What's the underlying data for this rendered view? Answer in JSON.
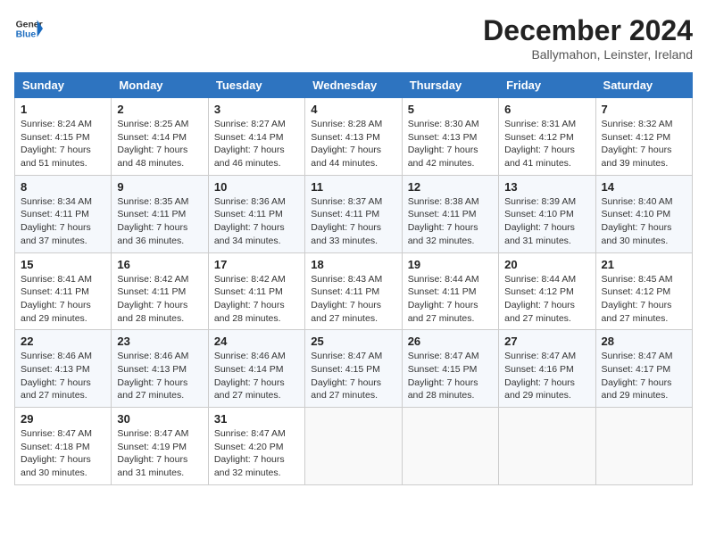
{
  "logo": {
    "line1": "General",
    "line2": "Blue"
  },
  "title": "December 2024",
  "subtitle": "Ballymahon, Leinster, Ireland",
  "days_header": [
    "Sunday",
    "Monday",
    "Tuesday",
    "Wednesday",
    "Thursday",
    "Friday",
    "Saturday"
  ],
  "weeks": [
    [
      {
        "day": "1",
        "sunrise": "8:24 AM",
        "sunset": "4:15 PM",
        "daylight": "7 hours and 51 minutes."
      },
      {
        "day": "2",
        "sunrise": "8:25 AM",
        "sunset": "4:14 PM",
        "daylight": "7 hours and 48 minutes."
      },
      {
        "day": "3",
        "sunrise": "8:27 AM",
        "sunset": "4:14 PM",
        "daylight": "7 hours and 46 minutes."
      },
      {
        "day": "4",
        "sunrise": "8:28 AM",
        "sunset": "4:13 PM",
        "daylight": "7 hours and 44 minutes."
      },
      {
        "day": "5",
        "sunrise": "8:30 AM",
        "sunset": "4:13 PM",
        "daylight": "7 hours and 42 minutes."
      },
      {
        "day": "6",
        "sunrise": "8:31 AM",
        "sunset": "4:12 PM",
        "daylight": "7 hours and 41 minutes."
      },
      {
        "day": "7",
        "sunrise": "8:32 AM",
        "sunset": "4:12 PM",
        "daylight": "7 hours and 39 minutes."
      }
    ],
    [
      {
        "day": "8",
        "sunrise": "8:34 AM",
        "sunset": "4:11 PM",
        "daylight": "7 hours and 37 minutes."
      },
      {
        "day": "9",
        "sunrise": "8:35 AM",
        "sunset": "4:11 PM",
        "daylight": "7 hours and 36 minutes."
      },
      {
        "day": "10",
        "sunrise": "8:36 AM",
        "sunset": "4:11 PM",
        "daylight": "7 hours and 34 minutes."
      },
      {
        "day": "11",
        "sunrise": "8:37 AM",
        "sunset": "4:11 PM",
        "daylight": "7 hours and 33 minutes."
      },
      {
        "day": "12",
        "sunrise": "8:38 AM",
        "sunset": "4:11 PM",
        "daylight": "7 hours and 32 minutes."
      },
      {
        "day": "13",
        "sunrise": "8:39 AM",
        "sunset": "4:10 PM",
        "daylight": "7 hours and 31 minutes."
      },
      {
        "day": "14",
        "sunrise": "8:40 AM",
        "sunset": "4:10 PM",
        "daylight": "7 hours and 30 minutes."
      }
    ],
    [
      {
        "day": "15",
        "sunrise": "8:41 AM",
        "sunset": "4:11 PM",
        "daylight": "7 hours and 29 minutes."
      },
      {
        "day": "16",
        "sunrise": "8:42 AM",
        "sunset": "4:11 PM",
        "daylight": "7 hours and 28 minutes."
      },
      {
        "day": "17",
        "sunrise": "8:42 AM",
        "sunset": "4:11 PM",
        "daylight": "7 hours and 28 minutes."
      },
      {
        "day": "18",
        "sunrise": "8:43 AM",
        "sunset": "4:11 PM",
        "daylight": "7 hours and 27 minutes."
      },
      {
        "day": "19",
        "sunrise": "8:44 AM",
        "sunset": "4:11 PM",
        "daylight": "7 hours and 27 minutes."
      },
      {
        "day": "20",
        "sunrise": "8:44 AM",
        "sunset": "4:12 PM",
        "daylight": "7 hours and 27 minutes."
      },
      {
        "day": "21",
        "sunrise": "8:45 AM",
        "sunset": "4:12 PM",
        "daylight": "7 hours and 27 minutes."
      }
    ],
    [
      {
        "day": "22",
        "sunrise": "8:46 AM",
        "sunset": "4:13 PM",
        "daylight": "7 hours and 27 minutes."
      },
      {
        "day": "23",
        "sunrise": "8:46 AM",
        "sunset": "4:13 PM",
        "daylight": "7 hours and 27 minutes."
      },
      {
        "day": "24",
        "sunrise": "8:46 AM",
        "sunset": "4:14 PM",
        "daylight": "7 hours and 27 minutes."
      },
      {
        "day": "25",
        "sunrise": "8:47 AM",
        "sunset": "4:15 PM",
        "daylight": "7 hours and 27 minutes."
      },
      {
        "day": "26",
        "sunrise": "8:47 AM",
        "sunset": "4:15 PM",
        "daylight": "7 hours and 28 minutes."
      },
      {
        "day": "27",
        "sunrise": "8:47 AM",
        "sunset": "4:16 PM",
        "daylight": "7 hours and 29 minutes."
      },
      {
        "day": "28",
        "sunrise": "8:47 AM",
        "sunset": "4:17 PM",
        "daylight": "7 hours and 29 minutes."
      }
    ],
    [
      {
        "day": "29",
        "sunrise": "8:47 AM",
        "sunset": "4:18 PM",
        "daylight": "7 hours and 30 minutes."
      },
      {
        "day": "30",
        "sunrise": "8:47 AM",
        "sunset": "4:19 PM",
        "daylight": "7 hours and 31 minutes."
      },
      {
        "day": "31",
        "sunrise": "8:47 AM",
        "sunset": "4:20 PM",
        "daylight": "7 hours and 32 minutes."
      },
      null,
      null,
      null,
      null
    ]
  ],
  "labels": {
    "sunrise": "Sunrise: ",
    "sunset": "Sunset: ",
    "daylight": "Daylight: "
  }
}
